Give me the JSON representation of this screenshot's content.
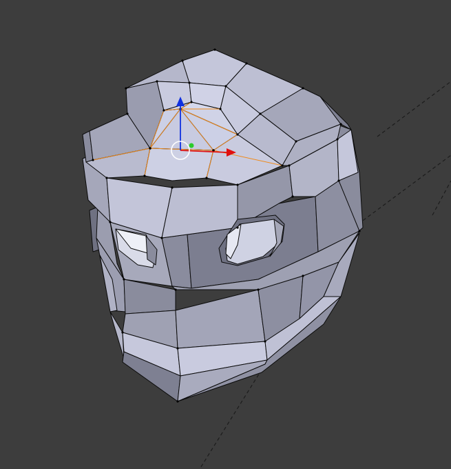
{
  "viewport": {
    "background": "#3d3d3d",
    "grid_color": "#1c1c1c",
    "mesh_face_light": "#c3c5d9",
    "mesh_face_mid": "#a4a6b9",
    "mesh_face_dark": "#7d7f90",
    "mesh_edge": "#0a0a0a",
    "selection_color": "#f08a1a",
    "gizmo_x_color": "#e01010",
    "gizmo_y_color": "#2ccb2c",
    "gizmo_z_color": "#1030e0",
    "cursor_icon": "3d-cursor-icon",
    "object": "helmet-mesh"
  }
}
